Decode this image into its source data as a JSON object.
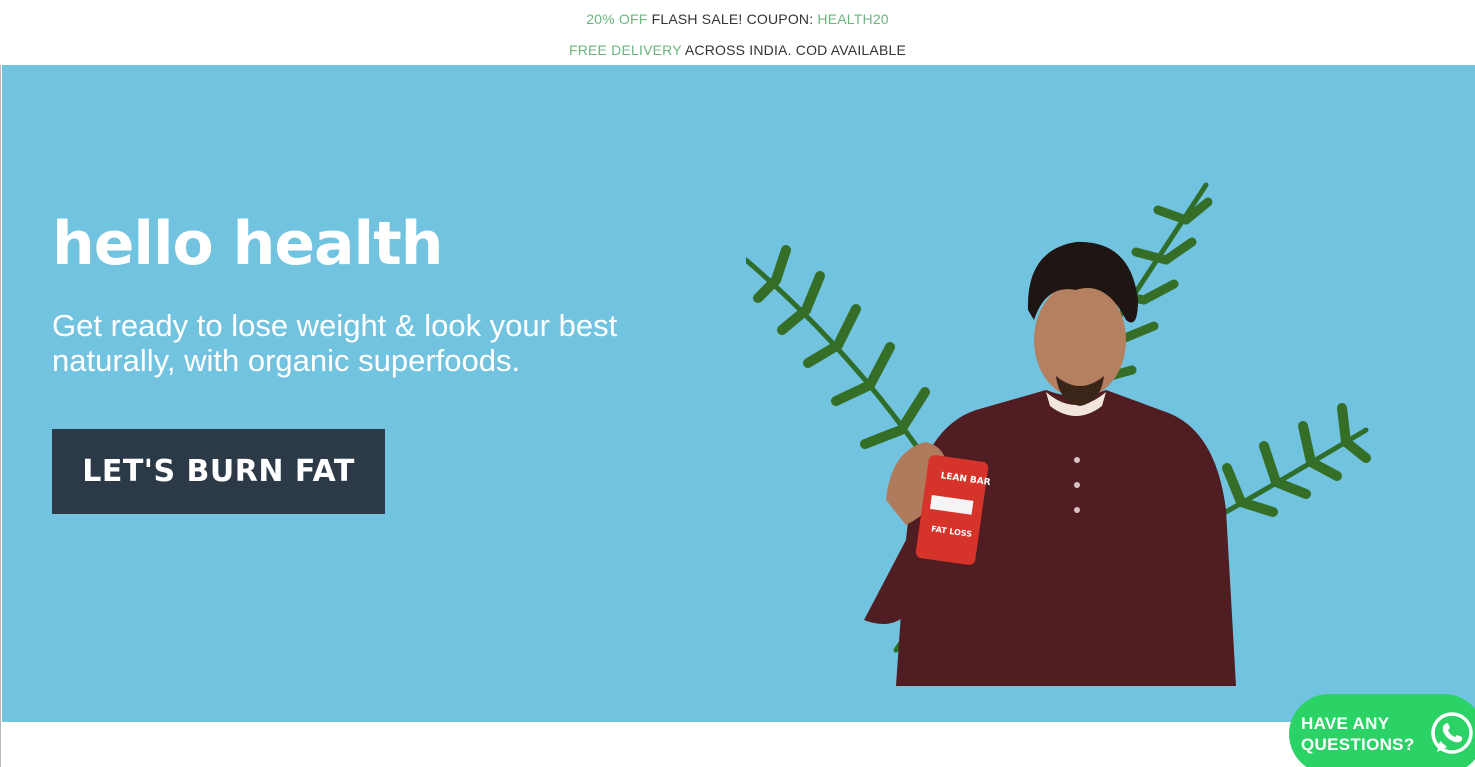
{
  "announcement": {
    "line1": {
      "highlight": "20% OFF",
      "text": " FLASH SALE! COUPON: ",
      "code": "HEALTH20"
    },
    "line2": {
      "highlight": "FREE DELIVERY",
      "text": " ACROSS INDIA. COD AVAILABLE"
    }
  },
  "hero": {
    "title": "hello health",
    "subtitle": "Get ready to lose weight & look your best naturally, with organic superfoods.",
    "cta_label": "LET'S BURN FAT",
    "product": {
      "brand": "LEAN BAR",
      "tagline": "FAT LOSS"
    }
  },
  "whatsapp": {
    "line1": "HAVE ANY",
    "line2": "QUESTIONS?"
  },
  "colors": {
    "hero_bg": "#72c3e0",
    "accent_green": "#6cb57f",
    "cta_bg": "#2c3a48",
    "whatsapp_green": "#2bd366"
  },
  "icons": {
    "whatsapp": "whatsapp-icon"
  }
}
